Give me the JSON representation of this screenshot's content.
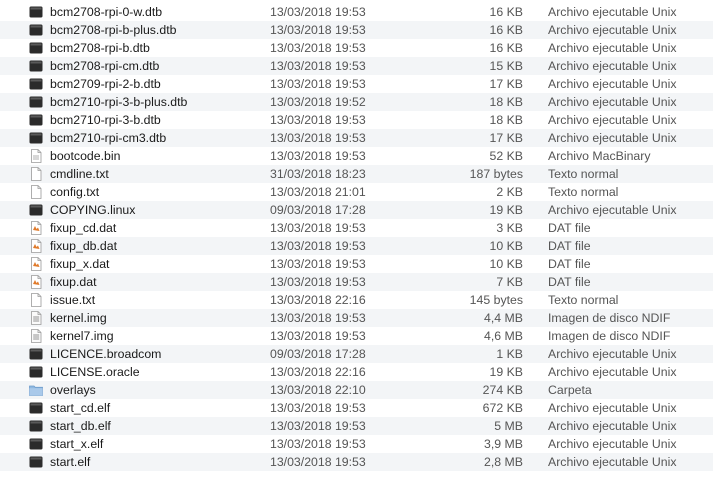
{
  "files": [
    {
      "name": "bcm2708-rpi-0-w.dtb",
      "date": "13/03/2018 19:53",
      "size": "16 KB",
      "kind": "Archivo ejecutable Unix",
      "icon": "unix-executable-icon"
    },
    {
      "name": "bcm2708-rpi-b-plus.dtb",
      "date": "13/03/2018 19:53",
      "size": "16 KB",
      "kind": "Archivo ejecutable Unix",
      "icon": "unix-executable-icon"
    },
    {
      "name": "bcm2708-rpi-b.dtb",
      "date": "13/03/2018 19:53",
      "size": "16 KB",
      "kind": "Archivo ejecutable Unix",
      "icon": "unix-executable-icon"
    },
    {
      "name": "bcm2708-rpi-cm.dtb",
      "date": "13/03/2018 19:53",
      "size": "15 KB",
      "kind": "Archivo ejecutable Unix",
      "icon": "unix-executable-icon"
    },
    {
      "name": "bcm2709-rpi-2-b.dtb",
      "date": "13/03/2018 19:53",
      "size": "17 KB",
      "kind": "Archivo ejecutable Unix",
      "icon": "unix-executable-icon"
    },
    {
      "name": "bcm2710-rpi-3-b-plus.dtb",
      "date": "13/03/2018 19:52",
      "size": "18 KB",
      "kind": "Archivo ejecutable Unix",
      "icon": "unix-executable-icon"
    },
    {
      "name": "bcm2710-rpi-3-b.dtb",
      "date": "13/03/2018 19:53",
      "size": "18 KB",
      "kind": "Archivo ejecutable Unix",
      "icon": "unix-executable-icon"
    },
    {
      "name": "bcm2710-rpi-cm3.dtb",
      "date": "13/03/2018 19:53",
      "size": "17 KB",
      "kind": "Archivo ejecutable Unix",
      "icon": "unix-executable-icon"
    },
    {
      "name": "bootcode.bin",
      "date": "13/03/2018 19:53",
      "size": "52 KB",
      "kind": "Archivo MacBinary",
      "icon": "binary-file-icon"
    },
    {
      "name": "cmdline.txt",
      "date": "31/03/2018 18:23",
      "size": "187 bytes",
      "kind": "Texto normal",
      "icon": "text-file-icon"
    },
    {
      "name": "config.txt",
      "date": "13/03/2018 21:01",
      "size": "2 KB",
      "kind": "Texto normal",
      "icon": "text-file-icon"
    },
    {
      "name": "COPYING.linux",
      "date": "09/03/2018 17:28",
      "size": "19 KB",
      "kind": "Archivo ejecutable Unix",
      "icon": "unix-executable-icon"
    },
    {
      "name": "fixup_cd.dat",
      "date": "13/03/2018 19:53",
      "size": "3 KB",
      "kind": "DAT file",
      "icon": "dat-file-icon"
    },
    {
      "name": "fixup_db.dat",
      "date": "13/03/2018 19:53",
      "size": "10 KB",
      "kind": "DAT file",
      "icon": "dat-file-icon"
    },
    {
      "name": "fixup_x.dat",
      "date": "13/03/2018 19:53",
      "size": "10 KB",
      "kind": "DAT file",
      "icon": "dat-file-icon"
    },
    {
      "name": "fixup.dat",
      "date": "13/03/2018 19:53",
      "size": "7 KB",
      "kind": "DAT file",
      "icon": "dat-file-icon"
    },
    {
      "name": "issue.txt",
      "date": "13/03/2018 22:16",
      "size": "145 bytes",
      "kind": "Texto normal",
      "icon": "text-file-icon"
    },
    {
      "name": "kernel.img",
      "date": "13/03/2018 19:53",
      "size": "4,4 MB",
      "kind": "Imagen de disco NDIF",
      "icon": "disk-image-icon"
    },
    {
      "name": "kernel7.img",
      "date": "13/03/2018 19:53",
      "size": "4,6 MB",
      "kind": "Imagen de disco NDIF",
      "icon": "disk-image-icon"
    },
    {
      "name": "LICENCE.broadcom",
      "date": "09/03/2018 17:28",
      "size": "1 KB",
      "kind": "Archivo ejecutable Unix",
      "icon": "unix-executable-icon"
    },
    {
      "name": "LICENSE.oracle",
      "date": "13/03/2018 22:16",
      "size": "19 KB",
      "kind": "Archivo ejecutable Unix",
      "icon": "unix-executable-icon"
    },
    {
      "name": "overlays",
      "date": "13/03/2018 22:10",
      "size": "274 KB",
      "kind": "Carpeta",
      "icon": "folder-icon"
    },
    {
      "name": "start_cd.elf",
      "date": "13/03/2018 19:53",
      "size": "672 KB",
      "kind": "Archivo ejecutable Unix",
      "icon": "unix-executable-icon"
    },
    {
      "name": "start_db.elf",
      "date": "13/03/2018 19:53",
      "size": "5 MB",
      "kind": "Archivo ejecutable Unix",
      "icon": "unix-executable-icon"
    },
    {
      "name": "start_x.elf",
      "date": "13/03/2018 19:53",
      "size": "3,9 MB",
      "kind": "Archivo ejecutable Unix",
      "icon": "unix-executable-icon"
    },
    {
      "name": "start.elf",
      "date": "13/03/2018 19:53",
      "size": "2,8 MB",
      "kind": "Archivo ejecutable Unix",
      "icon": "unix-executable-icon"
    }
  ],
  "colors": {
    "row_alt": "#f3f5f7",
    "folder": "#8fb8e0",
    "dat_accent": "#e07a2a",
    "exec_dark": "#2b2b2b"
  }
}
